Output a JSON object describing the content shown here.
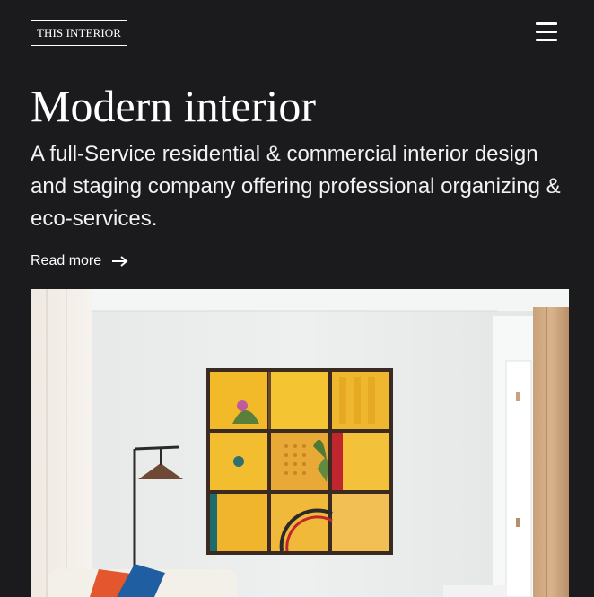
{
  "header": {
    "logo_text": "THIS INTERIOR",
    "menu_icon": "hamburger-menu-icon"
  },
  "hero": {
    "title": "Modern interior",
    "subtitle": "A full-Service residential & commercial interior design and staging company offering professional organizing & eco-services.",
    "read_more_label": "Read more",
    "read_more_icon": "arrow-right-icon"
  },
  "colors": {
    "background": "#1b1b1d",
    "text": "#ffffff"
  }
}
